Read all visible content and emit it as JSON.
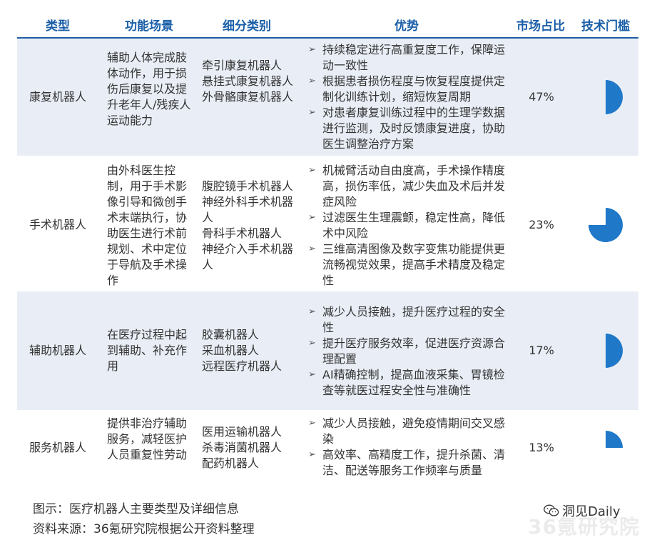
{
  "headers": {
    "type": "类型",
    "scenario": "功能场景",
    "subcategory": "细分类别",
    "advantages": "优势",
    "market_share": "市场占比",
    "tech_threshold": "技术门槛"
  },
  "rows": [
    {
      "type": "康复机器人",
      "scenario": "辅助人体完成肢体动作，用于损伤后康复以及提升老年人/残疾人运动能力",
      "subcategories": [
        "牵引康复机器人",
        "悬挂式康复机器人",
        "外骨骼康复机器人"
      ],
      "advantages": [
        "持续稳定进行高重复度工作，保障运动一致性",
        "根据患者损伤程度与恢复程度提供定制化训练计划，缩短恢复周期",
        "对患者康复训练过程中的生理学数据进行监测，及时反馈康复进度，协助医生调整治疗方案"
      ],
      "market_share": "47%",
      "threshold_fraction": 0.5
    },
    {
      "type": "手术机器人",
      "scenario": "由外科医生控制，用于手术影像引导和微创手术末端执行，协助医生进行术前规划、术中定位于导航及手术操作",
      "subcategories": [
        "腹腔镜手术机器人",
        "神经外科手术机器人",
        "骨科手术机器人",
        "神经介入手术机器人"
      ],
      "advantages": [
        "机械臂活动自由度高，手术操作精度高，损伤率低，减少失血及术后并发症风险",
        "过滤医生生理震颤，稳定性高，降低术中风险",
        "三维高清图像及数字变焦功能提供更流畅视觉效果，提高手术精度及稳定性"
      ],
      "market_share": "23%",
      "threshold_fraction": 0.75
    },
    {
      "type": "辅助机器人",
      "scenario": "在医疗过程中起到辅助、补充作用",
      "subcategories": [
        "胶囊机器人",
        "采血机器人",
        "远程医疗机器人"
      ],
      "advantages": [
        "减少人员接触，提升医疗过程的安全性",
        "提升医疗服务效率，促进医疗资源合理配置",
        "AI精确控制，提高血液采集、胃镜检查等就医过程安全性与准确性"
      ],
      "market_share": "17%",
      "threshold_fraction": 0.5
    },
    {
      "type": "服务机器人",
      "scenario": "提供非治疗辅助服务，减轻医护人员重复性劳动",
      "subcategories": [
        "医用运输机器人",
        "杀毒消菌机器人",
        "配药机器人"
      ],
      "advantages": [
        "减少人员接触，避免疫情期间交叉感染",
        "高效率、高精度工作，提升杀菌、清洁、配送等服务工作频率与质量"
      ],
      "market_share": "13%",
      "threshold_fraction": 0.25
    }
  ],
  "footer": {
    "caption": "图示：医疗机器人主要类型及详细信息",
    "source": "资料来源：36氪研究院根据公开资料整理"
  },
  "watermark": {
    "brand": "洞见Daily",
    "big": "36氪研究院"
  },
  "colors": {
    "header_text": "#1a5ea8",
    "row_shade": "#e9eef6",
    "pie": "#1f78c8"
  },
  "icons": {
    "bullet": "arrowhead-bullet-icon",
    "wechat": "wechat-icon"
  }
}
